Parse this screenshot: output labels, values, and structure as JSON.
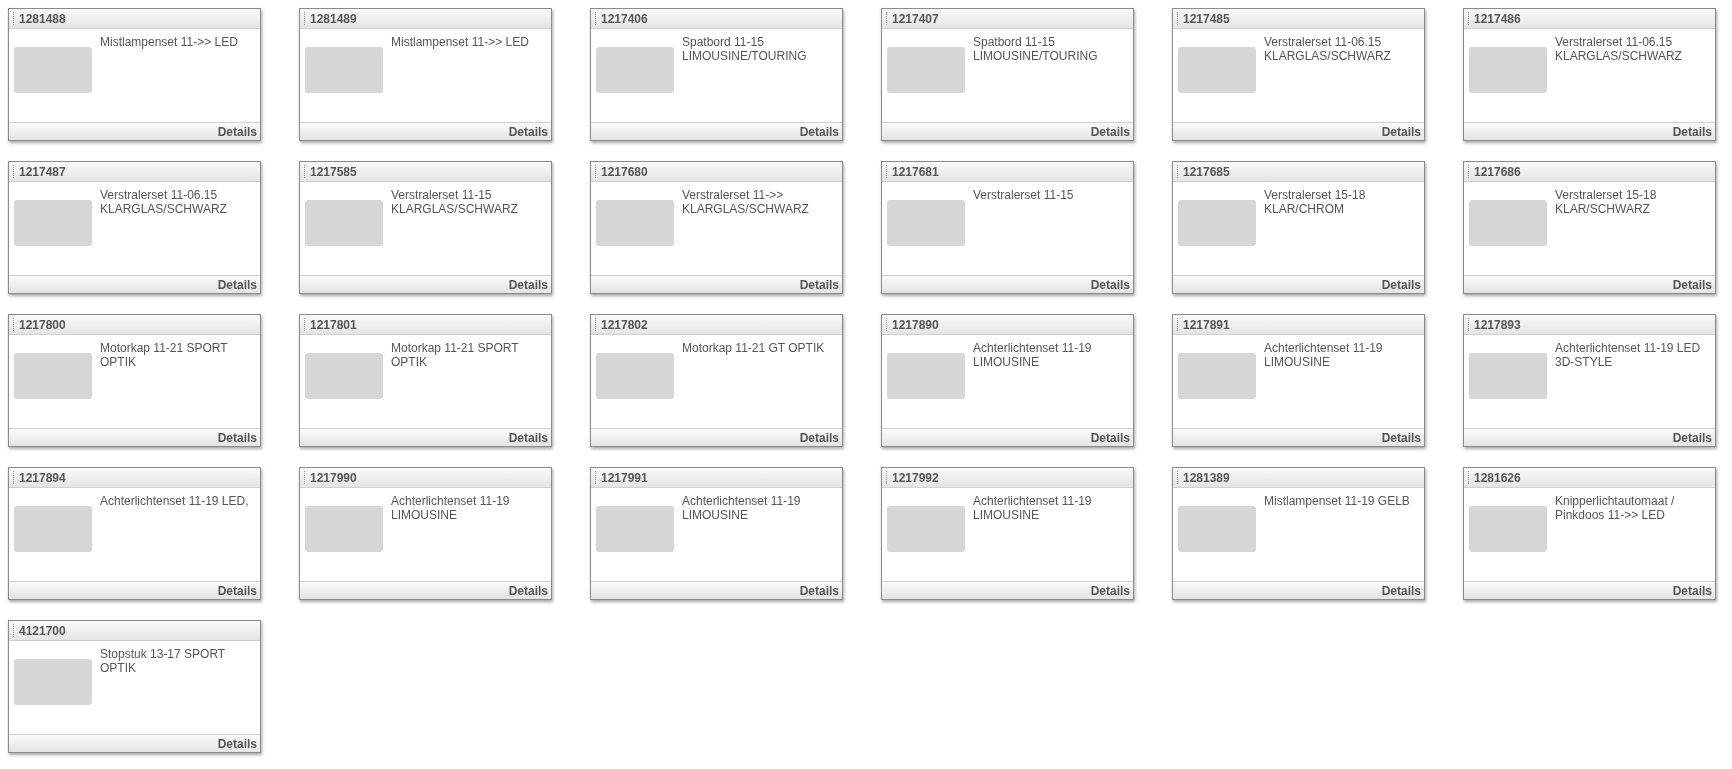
{
  "products": [
    {
      "number": "1281488",
      "title": "Mistlampenset 11->> LED",
      "link": "Details"
    },
    {
      "number": "1281489",
      "title": "Mistlampenset 11->> LED",
      "link": "Details"
    },
    {
      "number": "1217406",
      "title": "Spatbord 11-15 LIMOUSINE/TOURING",
      "link": "Details"
    },
    {
      "number": "1217407",
      "title": "Spatbord 11-15 LIMOUSINE/TOURING",
      "link": "Details"
    },
    {
      "number": "1217485",
      "title": "Verstralerset 11-06.15 KLARGLAS/SCHWARZ",
      "link": "Details"
    },
    {
      "number": "1217486",
      "title": "Verstralerset 11-06.15 KLARGLAS/SCHWARZ",
      "link": "Details"
    },
    {
      "number": "1217487",
      "title": "Verstralerset 11-06.15 KLARGLAS/SCHWARZ",
      "link": "Details"
    },
    {
      "number": "1217585",
      "title": "Verstralerset 11-15 KLARGLAS/SCHWARZ",
      "link": "Details"
    },
    {
      "number": "1217680",
      "title": "Verstralerset 11->> KLARGLAS/SCHWARZ",
      "link": "Details"
    },
    {
      "number": "1217681",
      "title": "Verstralerset 11-15",
      "link": "Details"
    },
    {
      "number": "1217685",
      "title": "Verstralerset 15-18 KLAR/CHROM",
      "link": "Details"
    },
    {
      "number": "1217686",
      "title": "Verstralerset 15-18 KLAR/SCHWARZ",
      "link": "Details"
    },
    {
      "number": "1217800",
      "title": "Motorkap 11-21 SPORT OPTIK",
      "link": "Details"
    },
    {
      "number": "1217801",
      "title": "Motorkap 11-21 SPORT OPTIK",
      "link": "Details"
    },
    {
      "number": "1217802",
      "title": "Motorkap 11-21 GT OPTIK",
      "link": "Details"
    },
    {
      "number": "1217890",
      "title": "Achterlichtenset 11-19 LIMOUSINE",
      "link": "Details"
    },
    {
      "number": "1217891",
      "title": "Achterlichtenset 11-19 LIMOUSINE",
      "link": "Details"
    },
    {
      "number": "1217893",
      "title": "Achterlichtenset 11-19 LED 3D-STYLE",
      "link": "Details"
    },
    {
      "number": "1217894",
      "title": "Achterlichtenset 11-19 LED,",
      "link": "Details"
    },
    {
      "number": "1217990",
      "title": "Achterlichtenset 11-19 LIMOUSINE",
      "link": "Details"
    },
    {
      "number": "1217991",
      "title": "Achterlichtenset 11-19 LIMOUSINE",
      "link": "Details"
    },
    {
      "number": "1217992",
      "title": "Achterlichtenset 11-19 LIMOUSINE",
      "link": "Details"
    },
    {
      "number": "1281389",
      "title": "Mistlampenset 11-19 GELB",
      "link": "Details"
    },
    {
      "number": "1281626",
      "title": "Knipperlichtautomaat / Pinkdoos 11->> LED",
      "link": "Details"
    },
    {
      "number": "4121700",
      "title": "Stopstuk 13-17 SPORT OPTIK",
      "link": "Details"
    }
  ]
}
